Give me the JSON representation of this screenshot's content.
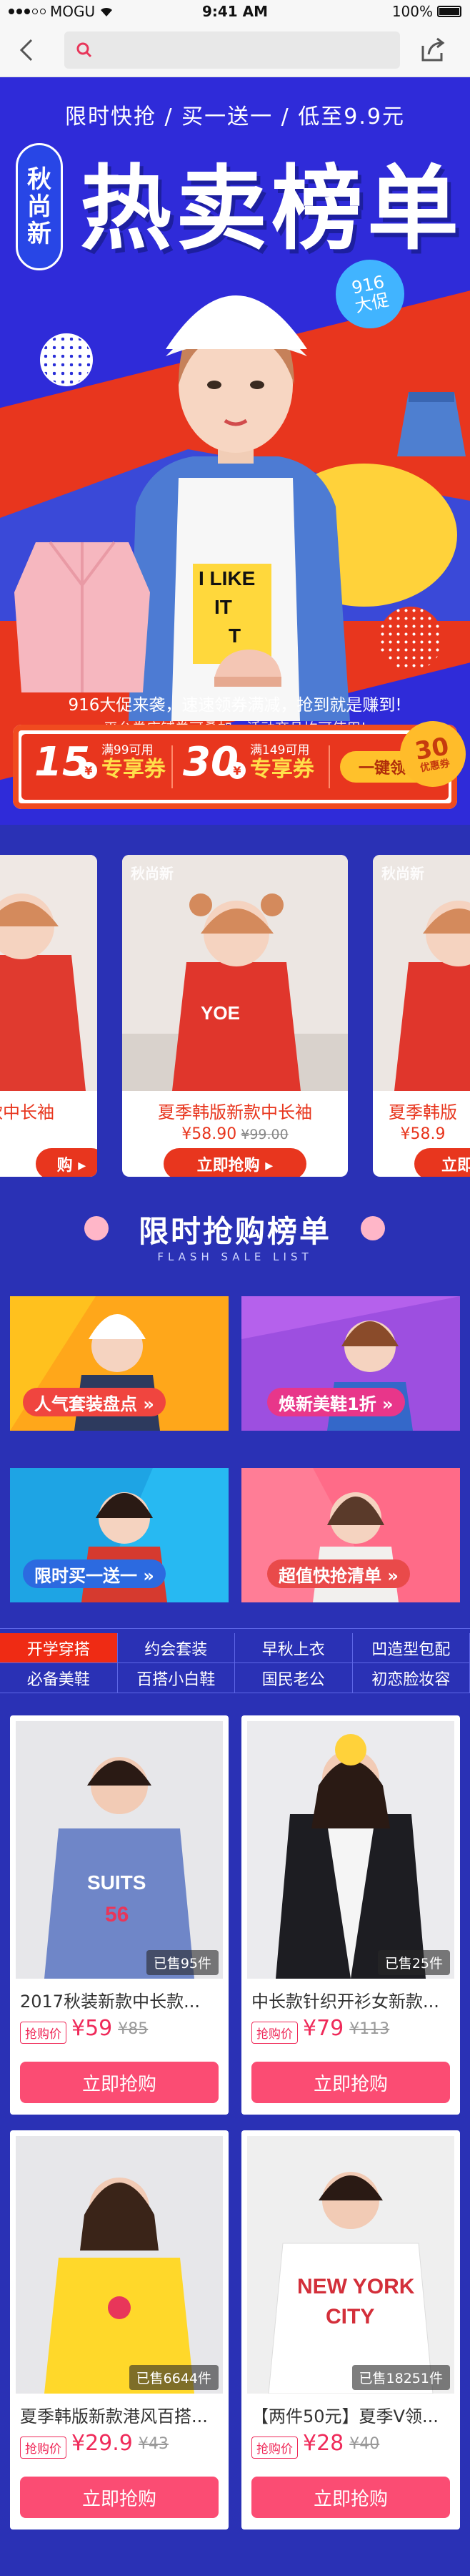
{
  "status_bar": {
    "carrier": "MOGU",
    "time": "9:41 AM",
    "battery": "100%"
  },
  "hero": {
    "slogan": "限时快抢 / 买一送一 / 低至9.9元",
    "vertical_badge": [
      "秋",
      "尚",
      "新"
    ],
    "title": "热卖榜单",
    "badge_916": {
      "line1": "916",
      "line2": "大促"
    },
    "promo_line1": "916大促来袭，速速领券满减，抢到就是赚到!",
    "promo_line2": "平台券店铺券可叠加，活动商品均可使用!",
    "badge_30": {
      "amount": "30",
      "unit": "优惠券"
    },
    "coupons": [
      {
        "amount": "15",
        "condition": "满99可用",
        "name": "专享券"
      },
      {
        "amount": "30",
        "condition": "满149可用",
        "name": "专享券"
      }
    ],
    "claim_button": "一键领取",
    "tshirt_text": [
      "I LIKE",
      "IT",
      "T"
    ]
  },
  "carousel": {
    "items": [
      {
        "name": "款中长袖",
        "price": "",
        "old_price": "",
        "button": "购 ▸",
        "logo": ""
      },
      {
        "name": "夏季韩版新款中长袖",
        "price": "¥58.90",
        "old_price": "¥99.00",
        "button": "立即抢购 ▸",
        "logo": "秋尚新"
      },
      {
        "name": "夏季韩版",
        "price": "¥58.9",
        "old_price": "",
        "button": "立即",
        "logo": "秋尚新"
      }
    ]
  },
  "section2": {
    "title": "限时抢购榜单",
    "subtitle": "FLASH SALE LIST"
  },
  "banners": [
    {
      "label": "人气套装盘点 »"
    },
    {
      "label": "焕新美鞋1折 »"
    },
    {
      "label": "限时买一送一 »"
    },
    {
      "label": "超值快抢清单 »"
    }
  ],
  "categories": [
    "开学穿搭",
    "约会套装",
    "早秋上衣",
    "凹造型包配",
    "必备美鞋",
    "百搭小白鞋",
    "国民老公",
    "初恋脸妆容"
  ],
  "products": [
    {
      "title": "2017秋装新款中长款...",
      "tag": "抢购价",
      "price": "¥59",
      "old_price": "¥85",
      "sold": "已售95件",
      "button": "立即抢购",
      "shirt_text": [
        "SUITS",
        "56"
      ]
    },
    {
      "title": "中长款针织开衫女新款...",
      "tag": "抢购价",
      "price": "¥79",
      "old_price": "¥113",
      "sold": "已售25件",
      "button": "立即抢购",
      "shirt_text": []
    },
    {
      "title": "夏季韩版新款港风百搭...",
      "tag": "抢购价",
      "price": "¥29.9",
      "old_price": "¥43",
      "sold": "已售6644件",
      "button": "立即抢购",
      "shirt_text": []
    },
    {
      "title": "【两件50元】夏季V领...",
      "tag": "抢购价",
      "price": "¥28",
      "old_price": "¥40",
      "sold": "已售18251件",
      "button": "立即抢购",
      "shirt_text": [
        "NEW YORK",
        "CITY"
      ]
    }
  ]
}
